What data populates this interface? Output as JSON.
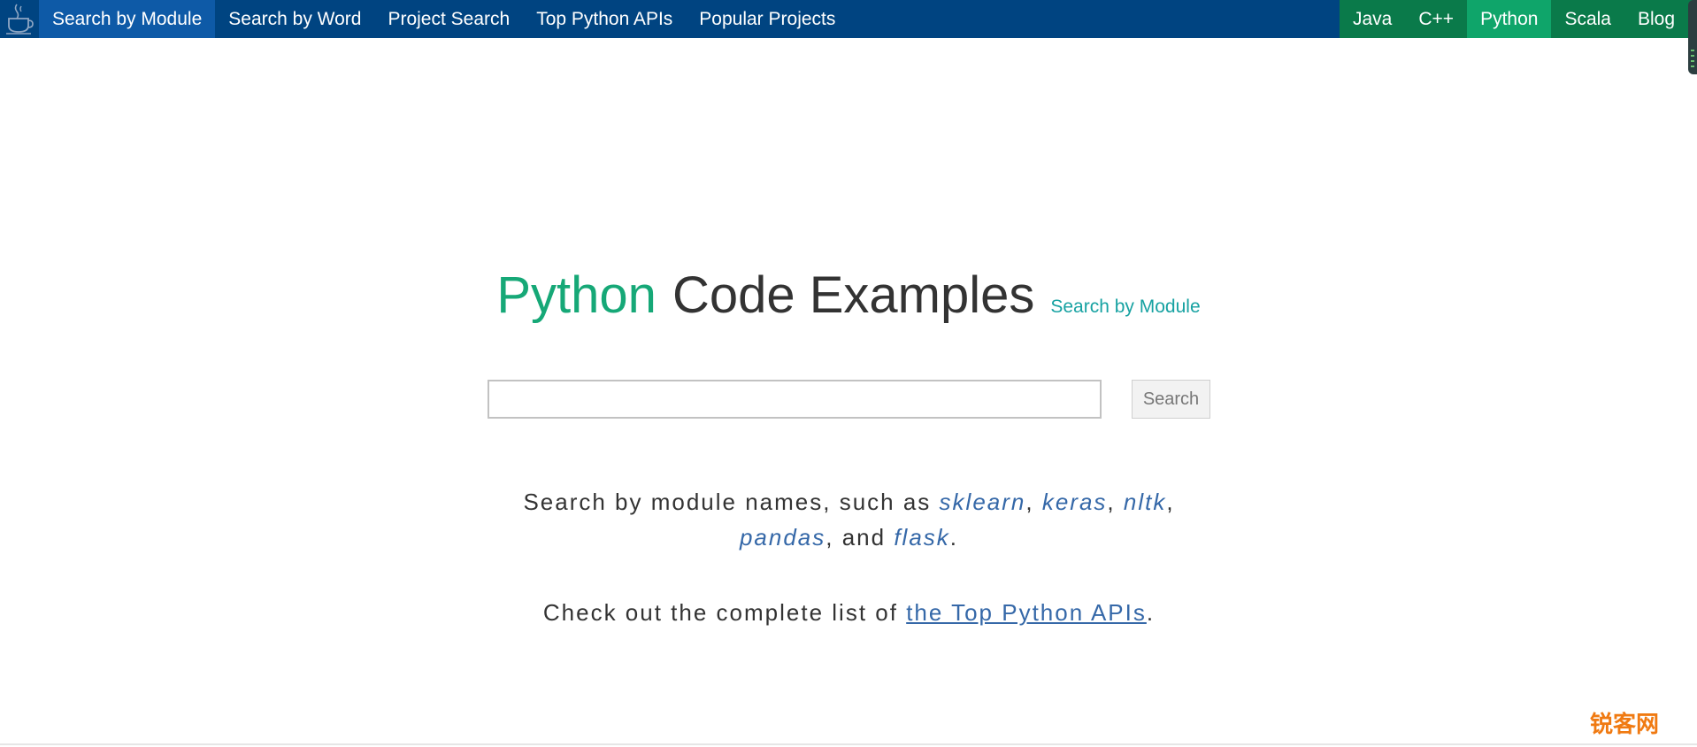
{
  "nav": {
    "logo_icon": "coffee-cup-icon",
    "left_items": [
      {
        "label": "Search by Module",
        "active": true
      },
      {
        "label": "Search by Word",
        "active": false
      },
      {
        "label": "Project Search",
        "active": false
      },
      {
        "label": "Top Python APIs",
        "active": false
      },
      {
        "label": "Popular Projects",
        "active": false
      }
    ],
    "lang_items": [
      {
        "label": "Java",
        "active": false
      },
      {
        "label": "C++",
        "active": false
      },
      {
        "label": "Python",
        "active": true
      },
      {
        "label": "Scala",
        "active": false
      },
      {
        "label": "Blog",
        "active": false
      }
    ],
    "colors": {
      "nav_bg": "#004481",
      "nav_active": "#0e5aa7",
      "lang_bg": "#0a7a4a",
      "lang_active": "#0fa56a"
    }
  },
  "hero": {
    "title_highlight": "Python",
    "title_rest": "Code Examples",
    "subtitle_link": "Search by Module",
    "colors": {
      "highlight": "#16a877",
      "subtitle": "#17a2a2"
    }
  },
  "search": {
    "value": "",
    "placeholder": "",
    "button_label": "Search"
  },
  "description": {
    "prefix": "Search by module names, such as ",
    "modules": [
      "sklearn",
      "keras",
      "nltk",
      "pandas",
      "flask"
    ],
    "sep1": ", ",
    "sep2": ", ",
    "sep3": ",",
    "sep4": ", and ",
    "suffix": "."
  },
  "checkout": {
    "prefix": "Check out the complete list of ",
    "link": "the Top Python APIs",
    "suffix": "."
  },
  "watermark": "锐客网"
}
